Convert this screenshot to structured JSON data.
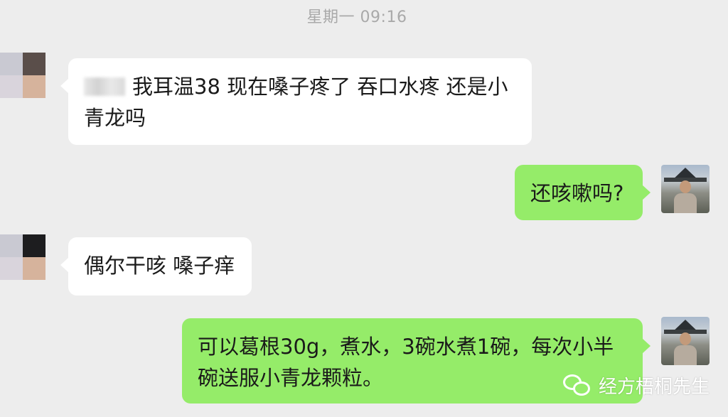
{
  "chat": {
    "timestamp": "星期一 09:16",
    "messages": [
      {
        "direction": "incoming",
        "text": "我耳温38 现在嗓子疼了 吞口水疼 还是小青龙吗"
      },
      {
        "direction": "outgoing",
        "text": "还咳嗽吗?"
      },
      {
        "direction": "incoming",
        "text": "偶尔干咳 嗓子痒"
      },
      {
        "direction": "outgoing",
        "text": "可以葛根30g，煮水，3碗水煮1碗，每次小半碗送服小青龙颗粒。"
      }
    ]
  },
  "watermark": {
    "icon": "wechat-icon",
    "text": "经方梧桐先生"
  },
  "colors": {
    "background": "#ededed",
    "incoming_bubble": "#ffffff",
    "outgoing_bubble": "#95ec69",
    "timestamp_text": "#a9a9a9"
  }
}
